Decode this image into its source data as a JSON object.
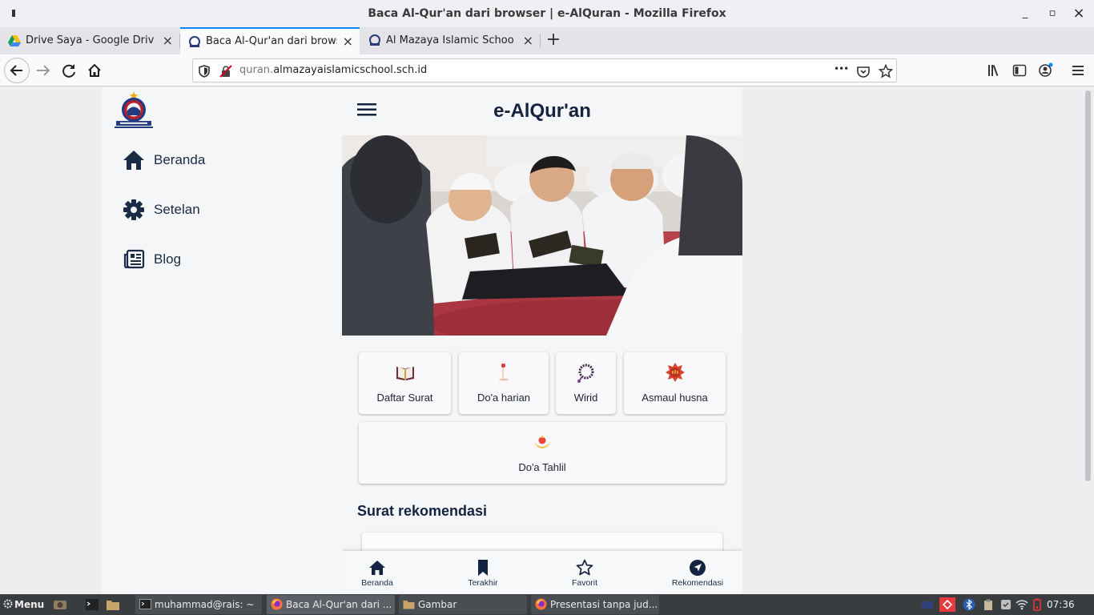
{
  "window": {
    "title": "Baca Al-Qur'an dari browser | e-AlQuran - Mozilla Firefox",
    "minimize": "_",
    "maximize": "▫",
    "close": "×"
  },
  "tabs": [
    {
      "label": "Drive Saya - Google Drive",
      "icon": "google-drive-icon",
      "close": "×"
    },
    {
      "label": "Baca Al-Qur'an dari browse",
      "icon": "school-logo-icon",
      "close": "×"
    },
    {
      "label": "Al Mazaya Islamic School",
      "icon": "school-logo-icon",
      "close": "×"
    }
  ],
  "new_tab": "+",
  "url": {
    "prefix": "quran.",
    "domain": "almazayaislamicschool.sch.id",
    "more": "•••"
  },
  "sidebar": {
    "items": [
      {
        "label": "Beranda",
        "icon": "home-icon"
      },
      {
        "label": "Setelan",
        "icon": "gear-icon"
      },
      {
        "label": "Blog",
        "icon": "newspaper-icon"
      }
    ]
  },
  "app": {
    "title": "e-AlQur'an",
    "menu": [
      {
        "label": "Daftar Surat",
        "icon": "quran-book-icon"
      },
      {
        "label": "Do'a harian",
        "icon": "prayer-icon"
      },
      {
        "label": "Wirid",
        "icon": "prayer-beads-icon"
      },
      {
        "label": "Asmaul husna",
        "icon": "allah-star-icon"
      },
      {
        "label": "Do'a Tahlil",
        "icon": "crescent-icon"
      }
    ],
    "section_title": "Surat rekomendasi",
    "bottom_nav": [
      {
        "label": "Beranda",
        "icon": "home-icon"
      },
      {
        "label": "Terakhir",
        "icon": "bookmark-icon"
      },
      {
        "label": "Favorit",
        "icon": "star-icon"
      },
      {
        "label": "Rekomendasi",
        "icon": "compass-icon"
      }
    ]
  },
  "taskbar": {
    "menu_label": "Menu",
    "tasks": [
      {
        "label": "muhammad@rais: ~",
        "icon": "terminal-icon"
      },
      {
        "label": "Baca Al-Qur'an dari ...",
        "icon": "firefox-icon"
      },
      {
        "label": "Gambar",
        "icon": "folder-icon"
      },
      {
        "label": "Presentasi tanpa jud...",
        "icon": "firefox-icon"
      }
    ],
    "clock": "07:36"
  },
  "colors": {
    "accent": "#0a84ff",
    "navy": "#14233f",
    "taskbar": "#3a3d40"
  }
}
